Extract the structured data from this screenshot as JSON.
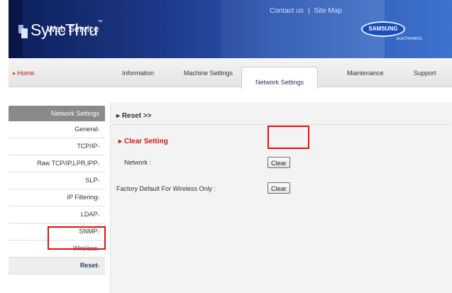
{
  "header": {
    "logo_title": "SyncThru",
    "logo_tm": "™",
    "logo_subtitle": "Web Service",
    "top_links": [
      "Contact us",
      "Site Map"
    ],
    "brand": "SAMSUNG",
    "brand_sub": "ELECTRONICS"
  },
  "nav": {
    "home": "Home",
    "tabs": [
      "Information",
      "Machine Settings",
      "Network Settings",
      "Maintenance",
      "Support"
    ],
    "active_tab": "Network Settings"
  },
  "sidebar": {
    "header": "Network Settings",
    "items": [
      {
        "label": "General"
      },
      {
        "label": "TCP/IP"
      },
      {
        "label": "Raw TCP/IP,LPR,IPP"
      },
      {
        "label": "SLP"
      },
      {
        "label": "IP Filtering"
      },
      {
        "label": "LDAP"
      },
      {
        "label": "SNMP"
      },
      {
        "label": "Wireless"
      },
      {
        "label": "Reset"
      }
    ],
    "active_item": "Reset"
  },
  "main": {
    "breadcrumb": "Reset >>",
    "section_title": "Clear Setting",
    "rows": [
      {
        "label": "Network :",
        "button": "Clear"
      },
      {
        "label": "Factory Default For Wireless Only :",
        "button": "Clear"
      }
    ]
  },
  "colors": {
    "banner": "#1d3a8a",
    "accent_red": "#d01818",
    "annotation": "#e01010"
  }
}
